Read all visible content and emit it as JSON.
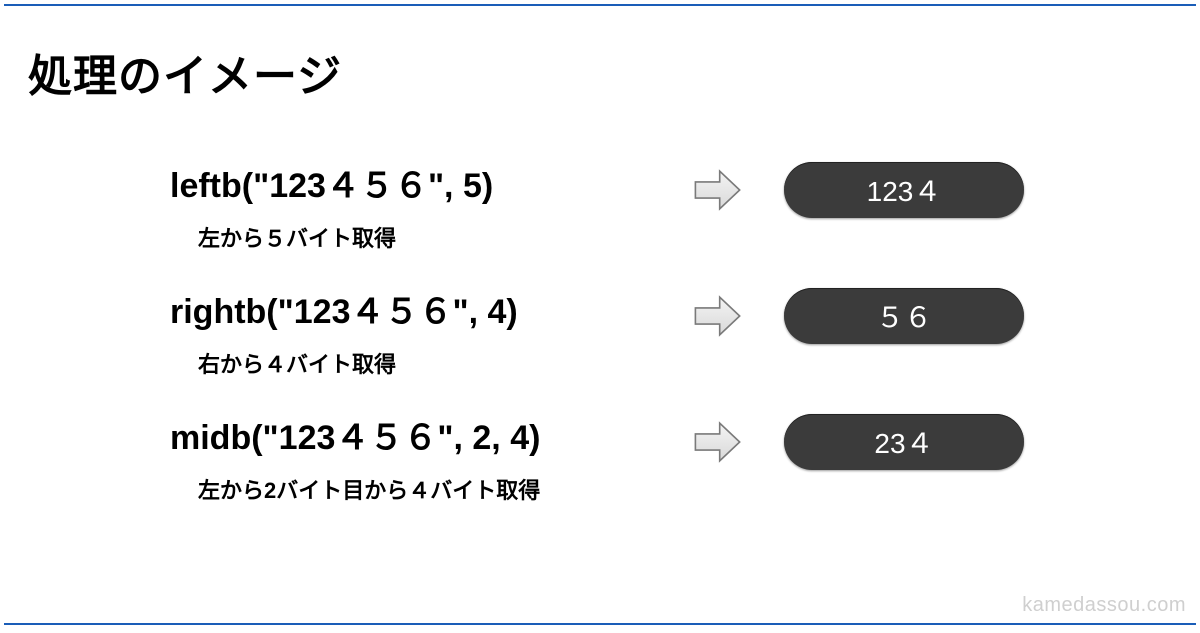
{
  "title": "処理のイメージ",
  "examples": [
    {
      "func": "leftb(\"123４５６\", 5)",
      "desc": "左から５バイト取得",
      "result": "123４"
    },
    {
      "func": "rightb(\"123４５６\", 4)",
      "desc": "右から４バイト取得",
      "result": "５６"
    },
    {
      "func": "midb(\"123４５６\", 2, 4)",
      "desc": "左から2バイト目から４バイト取得",
      "result": "23４"
    }
  ],
  "watermark": "kamedassou.com"
}
